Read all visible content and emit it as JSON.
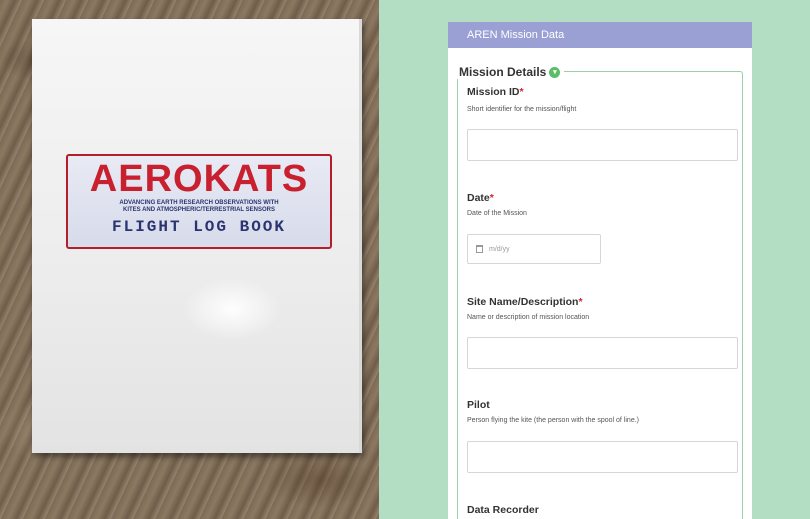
{
  "photo": {
    "book_brand": "AEROKATS",
    "book_tagline_line1": "Advancing Earth Research Observations with",
    "book_tagline_line2": "Kites and Atmospheric/Terrestrial Sensors",
    "book_subtitle": "FLIGHT LOG BOOK"
  },
  "form": {
    "header_title": "AREN Mission Data",
    "section_title": "Mission Details",
    "section_toggle_glyph": "▾",
    "required_mark": "*",
    "fields": {
      "mission_id": {
        "label": "Mission ID",
        "help": "Short identifier for the mission/flight",
        "value": ""
      },
      "date": {
        "label": "Date",
        "help": "Date of the Mission",
        "placeholder": "m/d/yy"
      },
      "site": {
        "label": "Site Name/Description",
        "help": "Name or description of mission location",
        "value": ""
      },
      "pilot": {
        "label": "Pilot",
        "help": "Person flying the kite (the person with the spool of line.)",
        "value": ""
      },
      "data_recorder": {
        "label": "Data Recorder"
      }
    }
  },
  "colors": {
    "background_green": "#b4dec4",
    "header_purple": "#9aa0d4",
    "required_red": "#d2262f",
    "section_border_green": "#9ed0a6",
    "toggle_green": "#5bbd68"
  }
}
